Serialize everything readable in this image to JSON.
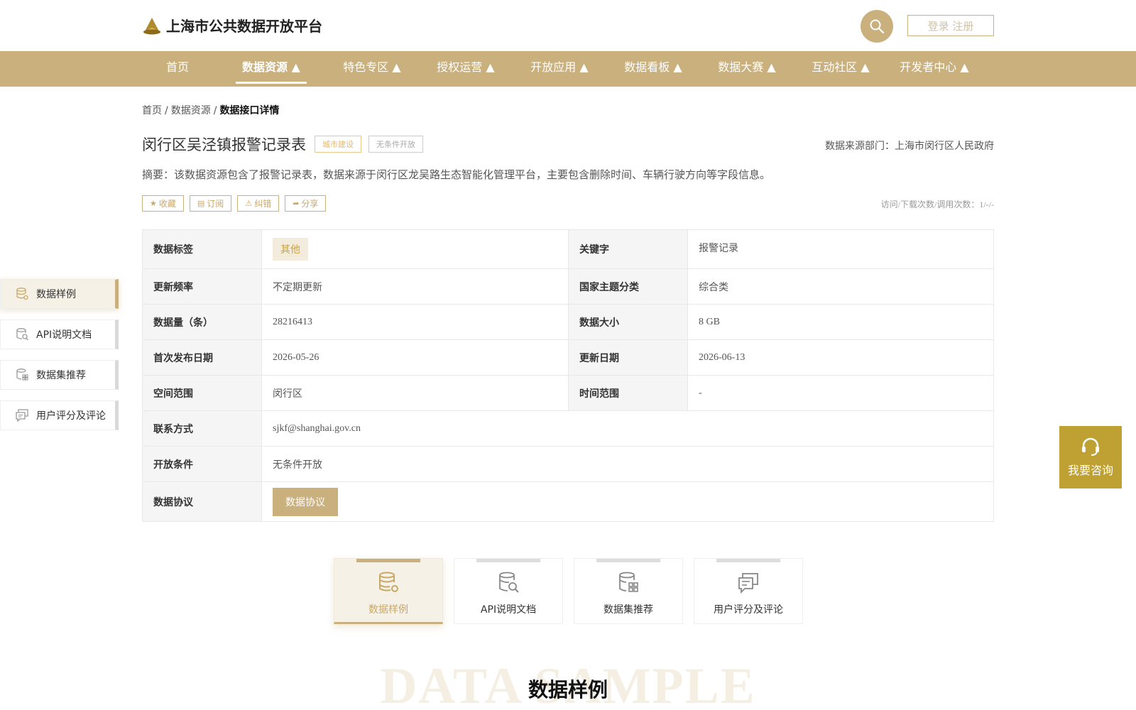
{
  "header": {
    "site_name": "上海市公共数据开放平台",
    "login_label": "登录 注册"
  },
  "nav": {
    "items": [
      {
        "label": "首页"
      },
      {
        "label": "数据资源 ▲"
      },
      {
        "label": "特色专区 ▲"
      },
      {
        "label": "授权运营 ▲"
      },
      {
        "label": "开放应用 ▲"
      },
      {
        "label": "数据看板 ▲"
      },
      {
        "label": "数据大赛 ▲"
      },
      {
        "label": "互动社区 ▲"
      },
      {
        "label": "开发者中心 ▲"
      }
    ],
    "active_index": 1
  },
  "breadcrumb": {
    "home": "首页",
    "parent": "数据资源",
    "current": "数据接口详情",
    "separator": "/"
  },
  "detail": {
    "title": "闵行区吴泾镇报警记录表",
    "tag_category": "城市建设",
    "tag_open": "无条件开放",
    "source_dept": "数据来源部门：上海市闵行区人民政府",
    "summary": "摘要：该数据资源包含了报警记录表，数据来源于闵行区龙吴路生态智能化管理平台，主要包含删除时间、车辆行驶方向等字段信息。",
    "actions": {
      "favorite": "收藏",
      "subscribe": "订阅",
      "report": "纠错",
      "share": "分享"
    },
    "visits": "访问/下载次数/调用次数：1/-/-"
  },
  "sidebar": {
    "items": [
      {
        "label": "数据样例"
      },
      {
        "label": "API说明文档"
      },
      {
        "label": "数据集推荐"
      },
      {
        "label": "用户评分及评论"
      }
    ]
  },
  "table": {
    "data_tag_label": "数据标签",
    "data_tag_value": "其他",
    "keyword_label": "关键字",
    "keyword_value": "报警记录",
    "update_freq_label": "更新频率",
    "update_freq_value": "不定期更新",
    "theme_label": "国家主题分类",
    "theme_value": "综合类",
    "count_label": "数据量（条）",
    "count_value": "28216413",
    "size_label": "数据大小",
    "size_value": "8 GB",
    "first_pub_label": "首次发布日期",
    "first_pub_value": "2026-05-26",
    "update_date_label": "更新日期",
    "update_date_value": "2026-06-13",
    "space_label": "空间范围",
    "space_value": "闵行区",
    "time_label": "时间范围",
    "time_value": "-",
    "contact_label": "联系方式",
    "contact_value": "sjkf@shanghai.gov.cn",
    "open_cond_label": "开放条件",
    "open_cond_value": "无条件开放",
    "agreement_label": "数据协议",
    "agreement_button": "数据协议"
  },
  "consult": {
    "label": "我要咨询"
  },
  "tabs": {
    "items": [
      {
        "label": "数据样例"
      },
      {
        "label": "API说明文档"
      },
      {
        "label": "数据集推荐"
      },
      {
        "label": "用户评分及评论"
      }
    ]
  },
  "section": {
    "bg_text": "DATA SAMPLE",
    "title": "数据样例"
  },
  "colors": {
    "brand_gold": "#c9b07d",
    "consult_gold": "#bfa032",
    "tag_gold": "#e2b870"
  }
}
